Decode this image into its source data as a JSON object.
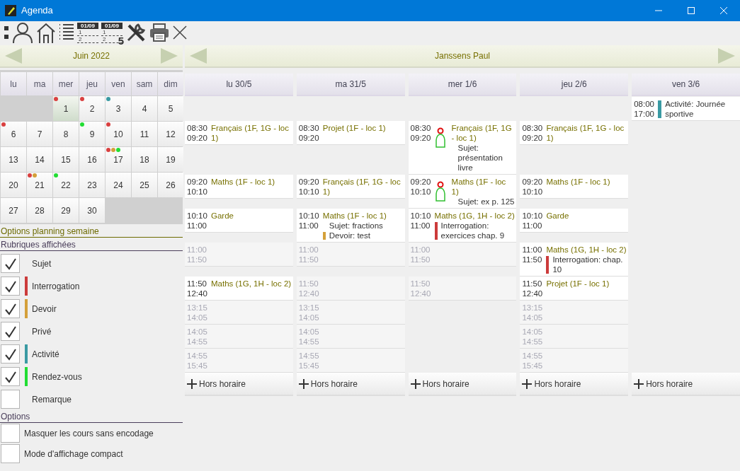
{
  "window": {
    "title": "Agenda"
  },
  "toolbar": [
    {
      "kind": "dots"
    },
    {
      "kind": "person"
    },
    {
      "kind": "home"
    },
    {
      "kind": "list"
    },
    {
      "kind": "datelist",
      "date": "01/09",
      "rows": [
        "1",
        "2"
      ]
    },
    {
      "kind": "datelist",
      "date": "01/09",
      "rows": [
        "1",
        "2"
      ],
      "badge": "5"
    },
    {
      "kind": "tools"
    },
    {
      "kind": "printer"
    },
    {
      "kind": "close"
    }
  ],
  "month": {
    "title": "Juin 2022",
    "weekdays": [
      "lu",
      "ma",
      "mer",
      "jeu",
      "ven",
      "sam",
      "dim"
    ],
    "days": [
      {
        "kind": "blank"
      },
      {
        "kind": "blank"
      },
      {
        "kind": "day",
        "label": "1",
        "selected": true,
        "dots": [
          {
            "color": "#d94040"
          }
        ]
      },
      {
        "kind": "day",
        "label": "2",
        "selected": false,
        "dots": [
          {
            "color": "#d94040"
          }
        ]
      },
      {
        "kind": "day",
        "label": "3",
        "selected": false,
        "dots": [
          {
            "color": "#3a9aa3"
          }
        ]
      },
      {
        "kind": "day",
        "label": "4",
        "selected": false
      },
      {
        "kind": "day",
        "label": "5",
        "selected": false
      },
      {
        "kind": "day",
        "label": "6",
        "selected": false,
        "dots": [
          {
            "color": "#d94040"
          }
        ]
      },
      {
        "kind": "day",
        "label": "7",
        "selected": false
      },
      {
        "kind": "day",
        "label": "8",
        "selected": false
      },
      {
        "kind": "day",
        "label": "9",
        "selected": false,
        "dots": [
          {
            "color": "#22dd33"
          }
        ]
      },
      {
        "kind": "day",
        "label": "10",
        "selected": false,
        "dots": [
          {
            "color": "#d94040"
          }
        ]
      },
      {
        "kind": "day",
        "label": "11",
        "selected": false
      },
      {
        "kind": "day",
        "label": "12",
        "selected": false
      },
      {
        "kind": "day",
        "label": "13",
        "selected": false
      },
      {
        "kind": "day",
        "label": "14",
        "selected": false
      },
      {
        "kind": "day",
        "label": "15",
        "selected": false
      },
      {
        "kind": "day",
        "label": "16",
        "selected": false
      },
      {
        "kind": "day",
        "label": "17",
        "selected": false,
        "dots": [
          {
            "color": "#d94040"
          },
          {
            "color": "#d4a03a"
          },
          {
            "color": "#22dd33"
          }
        ]
      },
      {
        "kind": "day",
        "label": "18",
        "selected": false
      },
      {
        "kind": "day",
        "label": "19",
        "selected": false
      },
      {
        "kind": "day",
        "label": "20",
        "selected": false
      },
      {
        "kind": "day",
        "label": "21",
        "selected": false,
        "dots": [
          {
            "color": "#d94040"
          },
          {
            "color": "#d4a03a"
          }
        ]
      },
      {
        "kind": "day",
        "label": "22",
        "selected": false,
        "dots": [
          {
            "color": "#22dd33"
          }
        ]
      },
      {
        "kind": "day",
        "label": "23",
        "selected": false
      },
      {
        "kind": "day",
        "label": "24",
        "selected": false
      },
      {
        "kind": "day",
        "label": "25",
        "selected": false
      },
      {
        "kind": "day",
        "label": "26",
        "selected": false
      },
      {
        "kind": "day",
        "label": "27",
        "selected": false
      },
      {
        "kind": "day",
        "label": "28",
        "selected": false
      },
      {
        "kind": "day",
        "label": "29",
        "selected": false
      },
      {
        "kind": "day",
        "label": "30",
        "selected": false
      },
      {
        "kind": "blank"
      },
      {
        "kind": "blank"
      },
      {
        "kind": "blank"
      }
    ]
  },
  "options_title": "Options planning semaine",
  "rubriques": {
    "title": "Rubriques affichées",
    "items": [
      {
        "label": "Sujet",
        "checked": true
      },
      {
        "label": "Interrogation",
        "checked": true,
        "color": "#cc3b3b"
      },
      {
        "label": "Devoir",
        "checked": true,
        "color": "#d4a03a"
      },
      {
        "label": "Privé",
        "checked": true
      },
      {
        "label": "Activité",
        "checked": true,
        "color": "#3a9aa3"
      },
      {
        "label": "Rendez-vous",
        "checked": true,
        "color": "#22dd33"
      },
      {
        "label": "Remarque",
        "checked": false
      }
    ]
  },
  "options": {
    "title": "Options",
    "items": [
      {
        "label": "Masquer les cours sans encodage",
        "checked": false
      },
      {
        "label": "Mode d'affichage compact",
        "checked": false
      }
    ]
  },
  "week": {
    "title": "Janssens Paul",
    "days": [
      {
        "label": "lu 30/5",
        "add_label": "Hors horaire",
        "slots": [
          {
            "kind": "none"
          },
          {
            "kind": "lesson",
            "start": "08:30",
            "end": "09:20",
            "title": "Français (1F, 1G - loc 1)"
          },
          {
            "kind": "lesson",
            "start": "09:20",
            "end": "10:10",
            "title": "Maths (1F - loc 1)"
          },
          {
            "kind": "lesson",
            "start": "10:10",
            "end": "11:00",
            "title": "Garde"
          },
          {
            "kind": "free",
            "start": "11:00",
            "end": "11:50"
          },
          {
            "kind": "lesson",
            "start": "11:50",
            "end": "12:40",
            "title": "Maths (1G, 1H - loc 2)"
          },
          {
            "kind": "free",
            "start": "13:15",
            "end": "14:05"
          },
          {
            "kind": "free",
            "start": "14:05",
            "end": "14:55"
          },
          {
            "kind": "free",
            "start": "14:55",
            "end": "15:45"
          }
        ]
      },
      {
        "label": "ma 31/5",
        "add_label": "Hors horaire",
        "slots": [
          {
            "kind": "none"
          },
          {
            "kind": "lesson",
            "start": "08:30",
            "end": "09:20",
            "title": "Projet (1F - loc 1)"
          },
          {
            "kind": "lesson",
            "start": "09:20",
            "end": "10:10",
            "title": "Français (1F, 1G - loc 1)"
          },
          {
            "kind": "lesson",
            "start": "10:10",
            "end": "11:00",
            "title": "Maths (1F - loc 1)",
            "notes": [
              {
                "text": "Sujet: fractions"
              },
              {
                "text": "Devoir: test",
                "color": "#d4a03a"
              }
            ]
          },
          {
            "kind": "free",
            "start": "11:00",
            "end": "11:50"
          },
          {
            "kind": "free",
            "start": "11:50",
            "end": "12:40"
          },
          {
            "kind": "free",
            "start": "13:15",
            "end": "14:05"
          },
          {
            "kind": "free",
            "start": "14:05",
            "end": "14:55"
          },
          {
            "kind": "free",
            "start": "14:55",
            "end": "15:45"
          }
        ]
      },
      {
        "label": "mer 1/6",
        "add_label": "Hors horaire",
        "slots": [
          {
            "kind": "none"
          },
          {
            "kind": "lesson",
            "start": "08:30",
            "end": "09:20",
            "title": "Français (1F, 1G - loc 1)",
            "marked": true,
            "notes": [
              {
                "text": "Sujet: présentation livre"
              }
            ]
          },
          {
            "kind": "lesson",
            "start": "09:20",
            "end": "10:10",
            "title": "Maths (1F - loc 1)",
            "marked": true,
            "notes": [
              {
                "text": "Sujet: ex p. 125"
              }
            ]
          },
          {
            "kind": "lesson",
            "start": "10:10",
            "end": "11:00",
            "title": "Maths (1G, 1H - loc 2)",
            "notes": [
              {
                "text": "Interrogation: exercices chap. 9",
                "color": "#cc3b3b"
              }
            ]
          },
          {
            "kind": "free",
            "start": "11:00",
            "end": "11:50"
          },
          {
            "kind": "free",
            "start": "11:50",
            "end": "12:40"
          },
          {
            "kind": "none"
          },
          {
            "kind": "none"
          },
          {
            "kind": "none"
          }
        ]
      },
      {
        "label": "jeu 2/6",
        "add_label": "Hors horaire",
        "slots": [
          {
            "kind": "none"
          },
          {
            "kind": "lesson",
            "start": "08:30",
            "end": "09:20",
            "title": "Français (1F, 1G - loc 1)"
          },
          {
            "kind": "lesson",
            "start": "09:20",
            "end": "10:10",
            "title": "Maths (1F - loc 1)"
          },
          {
            "kind": "lesson",
            "start": "10:10",
            "end": "11:00",
            "title": "Garde"
          },
          {
            "kind": "lesson",
            "start": "11:00",
            "end": "11:50",
            "title": "Maths (1G, 1H - loc 2)",
            "notes": [
              {
                "text": "Interrogation: chap. 10",
                "color": "#cc3b3b"
              }
            ]
          },
          {
            "kind": "lesson",
            "start": "11:50",
            "end": "12:40",
            "title": "Projet (1F - loc 1)"
          },
          {
            "kind": "free",
            "start": "13:15",
            "end": "14:05"
          },
          {
            "kind": "free",
            "start": "14:05",
            "end": "14:55"
          },
          {
            "kind": "free",
            "start": "14:55",
            "end": "15:45"
          }
        ]
      },
      {
        "label": "ven 3/6",
        "add_label": "Hors horaire",
        "slots": [
          {
            "kind": "activity",
            "start": "08:00",
            "end": "17:00",
            "text": "Activité: Journée sportive",
            "color": "#3a9aa3"
          },
          {
            "kind": "none"
          },
          {
            "kind": "none"
          },
          {
            "kind": "none"
          },
          {
            "kind": "none"
          },
          {
            "kind": "none"
          },
          {
            "kind": "none"
          },
          {
            "kind": "none"
          },
          {
            "kind": "none"
          }
        ]
      }
    ]
  }
}
